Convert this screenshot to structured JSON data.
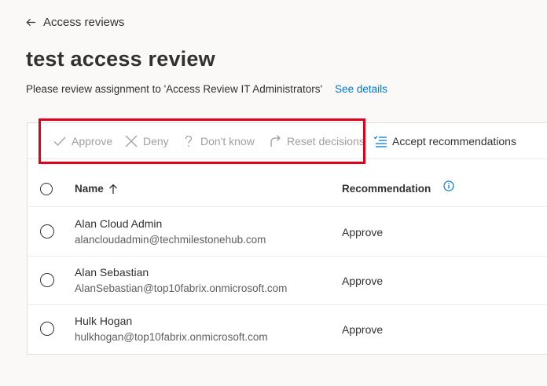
{
  "nav": {
    "back_label": "Access reviews"
  },
  "page": {
    "title": "test access review",
    "subtitle": "Please review assignment to 'Access Review IT Administrators'",
    "details_link": "See details"
  },
  "toolbar": {
    "approve": "Approve",
    "deny": "Deny",
    "dont_know": "Don't know",
    "reset": "Reset decisions",
    "accept": "Accept recommendations"
  },
  "table": {
    "columns": {
      "name": "Name",
      "recommendation": "Recommendation"
    },
    "rows": [
      {
        "name": "Alan Cloud Admin",
        "email": "alancloudadmin@techmilestonehub.com",
        "recommendation": "Approve"
      },
      {
        "name": "Alan Sebastian",
        "email": "AlanSebastian@top10fabrix.onmicrosoft.com",
        "recommendation": "Approve"
      },
      {
        "name": "Hulk Hogan",
        "email": "hulkhogan@top10fabrix.onmicrosoft.com",
        "recommendation": "Approve"
      }
    ]
  },
  "colors": {
    "accent": "#0078d4",
    "highlight": "#e3001b",
    "disabled": "#a19f9d"
  }
}
